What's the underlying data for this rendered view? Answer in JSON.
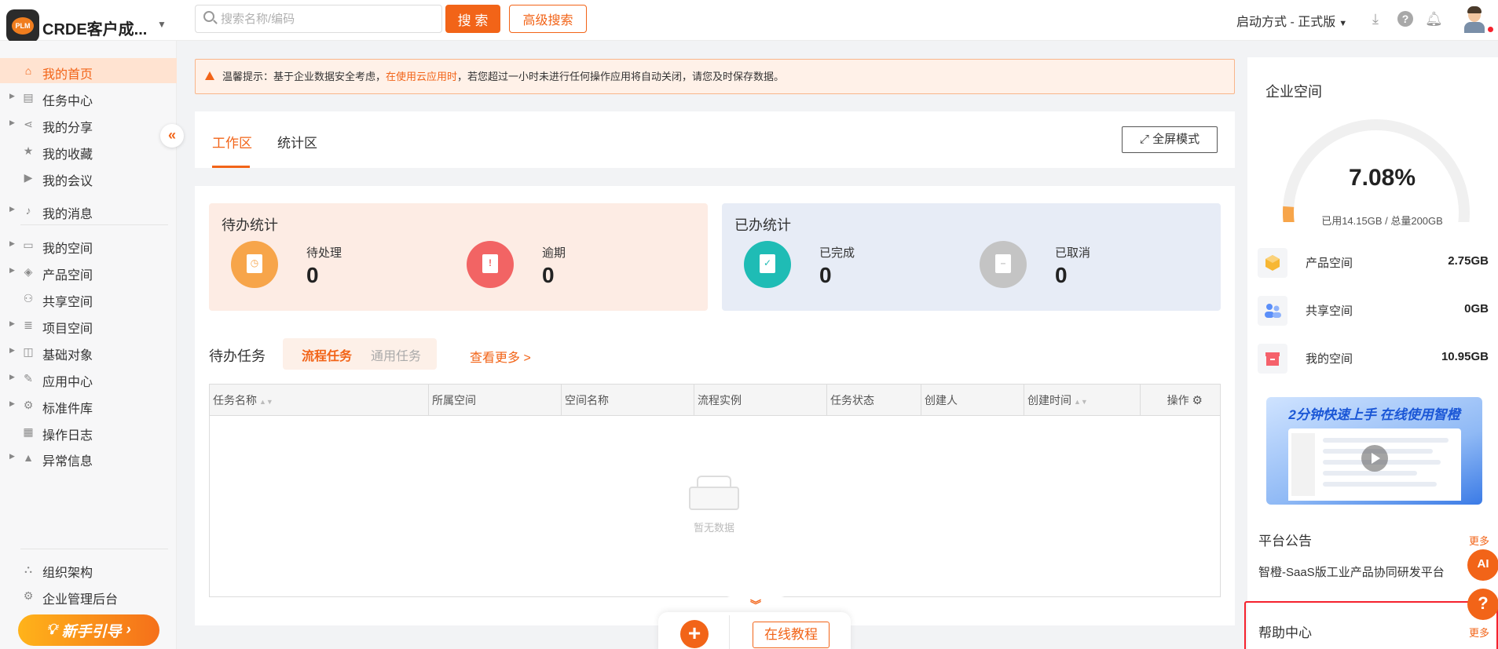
{
  "header": {
    "app_name": "CRDE客户成...",
    "logo_text": "PLM",
    "search_placeholder": "搜索名称/编码",
    "search_label": "搜 索",
    "advanced_search_label": "高级搜索",
    "launch_mode": "启动方式 - 正式版"
  },
  "sidebar": {
    "items": [
      {
        "label": "我的首页",
        "icon": "home-icon"
      },
      {
        "label": "任务中心",
        "icon": "clipboard-icon"
      },
      {
        "label": "我的分享",
        "icon": "share-icon"
      },
      {
        "label": "我的收藏",
        "icon": "star-icon"
      },
      {
        "label": "我的会议",
        "icon": "video-icon"
      },
      {
        "label": "我的消息",
        "icon": "bell-icon"
      },
      {
        "label": "我的空间",
        "icon": "box-icon"
      },
      {
        "label": "产品空间",
        "icon": "cube-icon"
      },
      {
        "label": "共享空间",
        "icon": "users-icon"
      },
      {
        "label": "项目空间",
        "icon": "database-icon"
      },
      {
        "label": "基础对象",
        "icon": "layers-icon"
      },
      {
        "label": "应用中心",
        "icon": "apps-icon"
      },
      {
        "label": "标准件库",
        "icon": "gear-icon"
      },
      {
        "label": "操作日志",
        "icon": "log-icon"
      },
      {
        "label": "异常信息",
        "icon": "warning-icon"
      }
    ],
    "bottom_items": [
      {
        "label": "组织架构",
        "icon": "org-icon"
      },
      {
        "label": "企业管理后台",
        "icon": "settings-icon"
      }
    ],
    "guide_label": "新手引导"
  },
  "notice": {
    "prefix": "温馨提示：基于企业数据安全考虑，",
    "highlight": "在使用云应用时",
    "suffix": "，若您超过一小时未进行任何操作应用将自动关闭，请您及时保存数据。"
  },
  "tabs": {
    "work": "工作区",
    "stats": "统计区",
    "fullscreen": "全屏模式"
  },
  "todo_stats": {
    "title": "待办统计",
    "pending_label": "待处理",
    "pending_value": "0",
    "overdue_label": "逾期",
    "overdue_value": "0"
  },
  "done_stats": {
    "title": "已办统计",
    "completed_label": "已完成",
    "completed_value": "0",
    "cancelled_label": "已取消",
    "cancelled_value": "0"
  },
  "pending_tasks": {
    "title": "待办任务",
    "tab_flow": "流程任务",
    "tab_general": "通用任务",
    "view_more": "查看更多 >",
    "columns": [
      "任务名称",
      "所属空间",
      "空间名称",
      "流程实例",
      "任务状态",
      "创建人",
      "创建时间",
      "操作"
    ],
    "empty_text": "暂无数据"
  },
  "bottom_bar": {
    "tutorial_label": "在线教程"
  },
  "enterprise_space": {
    "title": "企业空间",
    "percent": "7.08%",
    "usage_fraction": 0.0708,
    "usage_text": "已用14.15GB / 总量200GB",
    "items": [
      {
        "name": "产品空间",
        "size": "2.75GB"
      },
      {
        "name": "共享空间",
        "size": "0GB"
      },
      {
        "name": "我的空间",
        "size": "10.95GB"
      }
    ],
    "banner_text": "2分钟快速上手 在线使用智橙"
  },
  "announcements": {
    "title": "平台公告",
    "more": "更多",
    "text": "智橙-SaaS版工业产品协同研发平台"
  },
  "help_center": {
    "title": "帮助中心",
    "more": "更多"
  },
  "float_buttons": {
    "ai": "AI",
    "help": "?"
  },
  "colors": {
    "accent": "#f26418",
    "todo_bg": "#fdece4",
    "done_bg": "#e7ecf6",
    "pending_circle": "#f7a54a",
    "overdue_circle": "#f26464",
    "completed_circle": "#1fbcb5",
    "cancelled_circle": "#c4c4c4"
  }
}
